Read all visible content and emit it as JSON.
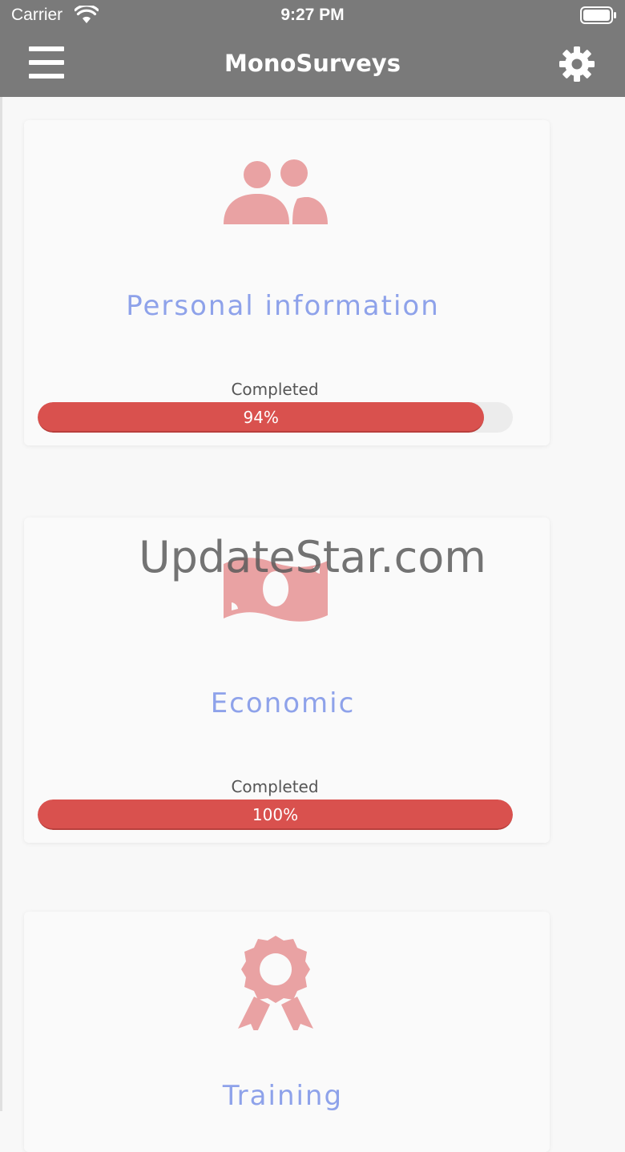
{
  "status_bar": {
    "carrier": "Carrier",
    "time": "9:27 PM",
    "wifi_icon": "wifi-icon",
    "battery_icon": "battery-icon"
  },
  "nav": {
    "title": "MonoSurveys",
    "menu_icon": "hamburger-menu-icon",
    "settings_icon": "gear-icon"
  },
  "colors": {
    "bar_background": "#7a7a7a",
    "title_color": "#8ea2ea",
    "icon_color": "#e9a2a3",
    "progress_color": "#d9514e"
  },
  "cards": [
    {
      "icon": "users-icon",
      "title": "Personal information",
      "status": "Completed",
      "progress_label": "94%",
      "progress": 94
    },
    {
      "icon": "money-bill-icon",
      "title": "Economic",
      "status": "Completed",
      "progress_label": "100%",
      "progress": 100
    },
    {
      "icon": "award-ribbon-icon",
      "title": "Training"
    }
  ],
  "watermark": "UpdateStar.com"
}
